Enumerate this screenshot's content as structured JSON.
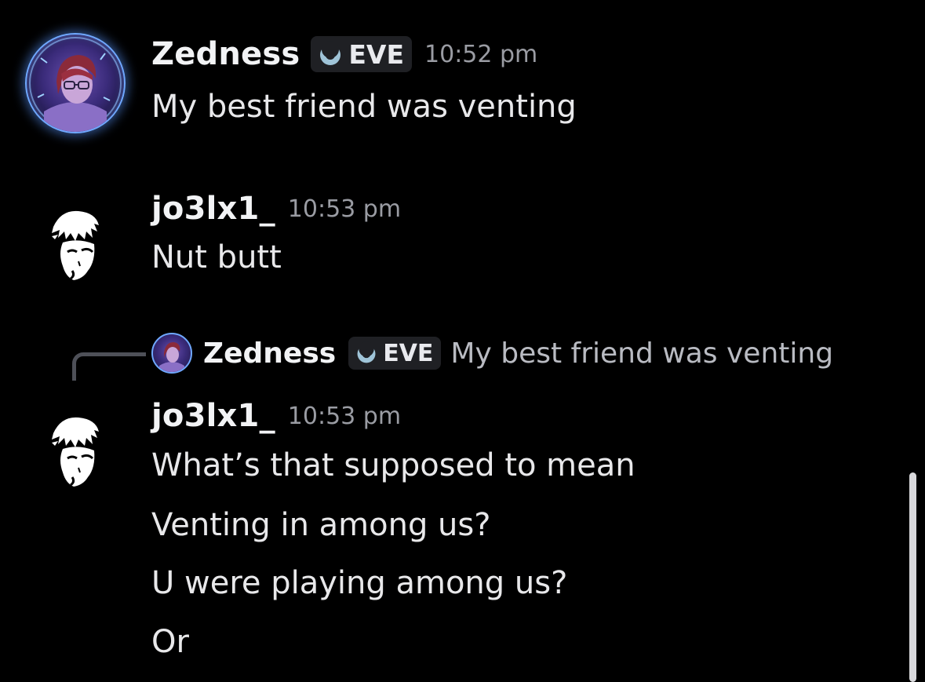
{
  "messages": [
    {
      "username": "Zedness",
      "tag": "EVE",
      "time": "10:52 pm",
      "lines": [
        "My best friend was venting"
      ]
    },
    {
      "username": "jo3lx1_",
      "time": "10:53 pm",
      "lines": [
        "Nut butt"
      ]
    },
    {
      "reply": {
        "username": "Zedness",
        "tag": "EVE",
        "text": "My best friend was venting"
      },
      "username": "jo3lx1_",
      "time": "10:53 pm",
      "lines": [
        "What’s that supposed to mean",
        "Venting in among us?",
        "U were playing among us?",
        "Or"
      ]
    }
  ],
  "icons": {
    "guild_tag": "crescent-moon-icon"
  },
  "colors": {
    "background": "#000000",
    "username": "#f2f3f5",
    "timestamp": "#9a9ca3",
    "tag_background": "#1f2024",
    "tag_icon": "#9fc4d8",
    "avatar_glow": "#6fa8ff"
  }
}
